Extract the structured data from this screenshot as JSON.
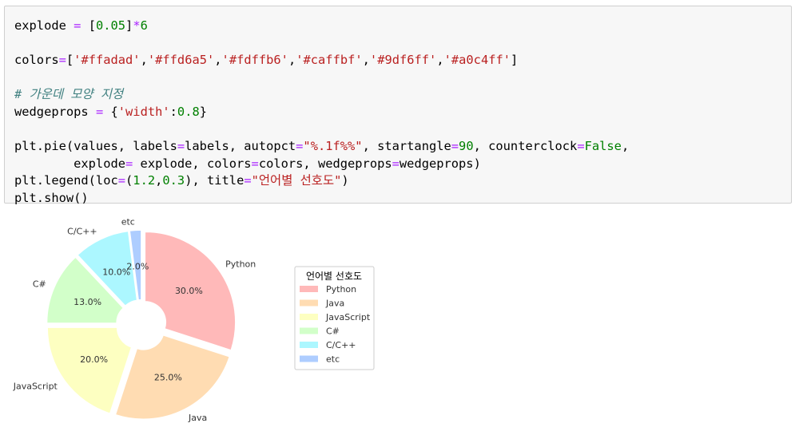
{
  "code": {
    "line1": {
      "a": "explode ",
      "op1": "=",
      "b": " [",
      "n1": "0.05",
      "c": "]",
      "op2": "*",
      "n2": "6"
    },
    "line3": {
      "a": "colors",
      "op1": "=",
      "b": "[",
      "s1": "'#ffadad'",
      "c1": ",",
      "s2": "'#ffd6a5'",
      "c2": ",",
      "s3": "'#fdffb6'",
      "c3": ",",
      "s4": "'#caffbf'",
      "c4": ",",
      "s5": "'#9df6ff'",
      "c5": ",",
      "s6": "'#a0c4ff'",
      "d": "]"
    },
    "line5": {
      "comment": "# 가운데 모양 지정"
    },
    "line6": {
      "a": "wedgeprops ",
      "op1": "=",
      "b": " {",
      "s1": "'width'",
      "c": ":",
      "n1": "0.8",
      "d": "}"
    },
    "line8": {
      "a": "plt.pie(values, labels",
      "op1": "=",
      "b": "labels, autopct",
      "op2": "=",
      "s1": "\"%.1f%%\"",
      "c": ", startangle",
      "op3": "=",
      "n1": "90",
      "d": ", counterclock",
      "op4": "=",
      "k1": "False",
      "e": ","
    },
    "line9": {
      "a": "        explode",
      "op1": "=",
      "b": " explode, colors",
      "op2": "=",
      "c": "colors, wedgeprops",
      "op3": "=",
      "d": "wedgeprops)"
    },
    "line10": {
      "a": "plt.legend(loc",
      "op1": "=",
      "b": "(",
      "n1": "1.2",
      "c": ",",
      "n2": "0.3",
      "d": "), title",
      "op2": "=",
      "s1": "\"언어별 선호도\"",
      "e": ")"
    },
    "line11": {
      "a": "plt.show()"
    }
  },
  "chart_data": {
    "type": "pie",
    "categories": [
      "Python",
      "Java",
      "JavaScript",
      "C#",
      "C/C++",
      "etc"
    ],
    "values": [
      30,
      25,
      20,
      13,
      10,
      2
    ],
    "value_labels": [
      "30.0%",
      "25.0%",
      "20.0%",
      "13.0%",
      "10.0%",
      "2.0%"
    ],
    "colors": [
      "#ffadad",
      "#ffd6a5",
      "#fdffb6",
      "#caffbf",
      "#9df6ff",
      "#a0c4ff"
    ],
    "alpha": 0.85,
    "startangle": 90,
    "counterclock": false,
    "explode": 0.05,
    "donut": true,
    "legend_title": "언어별 선호도",
    "legend_position": "right"
  }
}
